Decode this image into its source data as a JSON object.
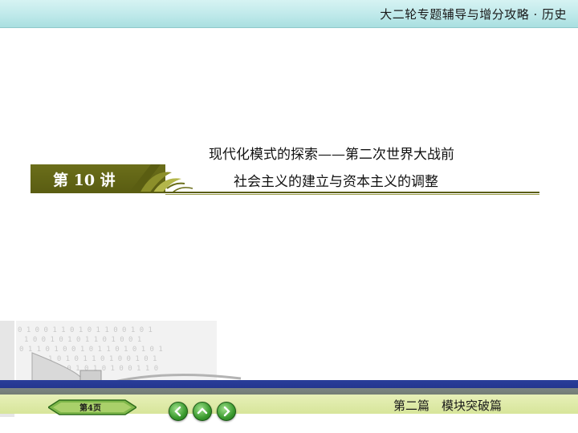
{
  "header": {
    "title": "大二轮专题辅导与增分攻略 · 历史"
  },
  "lesson": {
    "tag": "第 10 讲",
    "title_line1": "现代化模式的探索——第二次世界大战前",
    "title_line2": "社会主义的建立与资本主义的调整"
  },
  "footer": {
    "page_label": "第4页",
    "section_label": "第二篇　模块突破篇",
    "nav_prev_icon": "arrow-left-icon",
    "nav_home_icon": "arrow-up-icon",
    "nav_next_icon": "arrow-right-icon"
  },
  "colors": {
    "topbar": "#bfe9ea",
    "lesson_block": "#5a5d12",
    "bottom_band": "#1f2f86",
    "nav_button": "#3a9a2e"
  }
}
